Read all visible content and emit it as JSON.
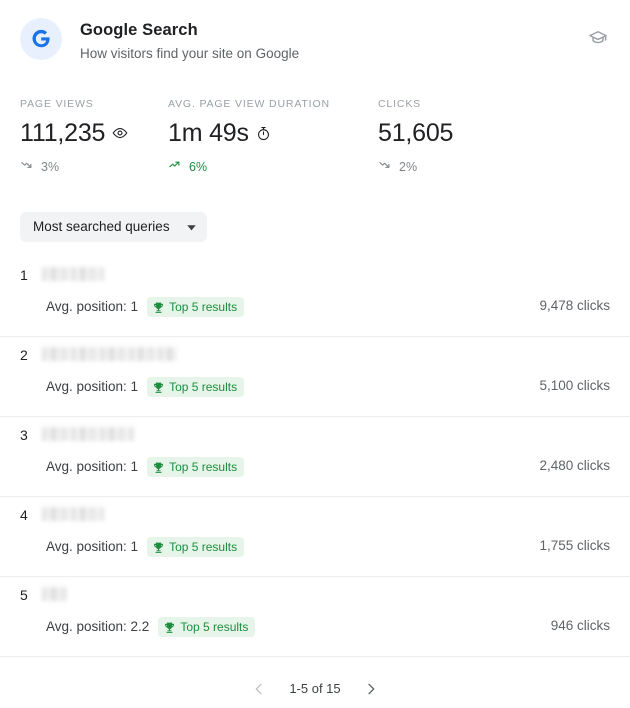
{
  "header": {
    "logo_icon": "google-g-icon",
    "title": "Google Search",
    "subtitle": "How visitors find your site on Google",
    "action_icon": "graduation-cap-icon",
    "logo_color": "#1a73e8",
    "logo_bg": "#e8f0fe"
  },
  "metrics": [
    {
      "label": "PAGE VIEWS",
      "value": "111,235",
      "icon": "eye-icon",
      "trend_direction": "down",
      "trend_icon": "trend-down-icon",
      "trend_value": "3%",
      "trend_color": "#80868b"
    },
    {
      "label": "AVG. PAGE VIEW DURATION",
      "value": "1m 49s",
      "icon": "stopwatch-icon",
      "trend_direction": "up",
      "trend_icon": "trend-up-icon",
      "trend_value": "6%",
      "trend_color": "#1e8e3e"
    },
    {
      "label": "CLICKS",
      "value": "51,605",
      "icon": "",
      "trend_direction": "down",
      "trend_icon": "trend-down-icon",
      "trend_value": "2%",
      "trend_color": "#80868b"
    }
  ],
  "filter": {
    "selected": "Most searched queries",
    "caret_icon": "chevron-down-icon"
  },
  "list": {
    "badge_icon": "trophy-icon",
    "badge_color": "#1e8e3e",
    "badge_bg": "#e6f4ea",
    "rows": [
      {
        "rank": "1",
        "query_redacted": true,
        "query_width": 62,
        "avg_position": "Avg. position: 1",
        "badge_label": "Top 5 results",
        "clicks": "9,478 clicks"
      },
      {
        "rank": "2",
        "query_redacted": true,
        "query_width": 135,
        "avg_position": "Avg. position: 1",
        "badge_label": "Top 5 results",
        "clicks": "5,100 clicks"
      },
      {
        "rank": "3",
        "query_redacted": true,
        "query_width": 92,
        "avg_position": "Avg. position: 1",
        "badge_label": "Top 5 results",
        "clicks": "2,480 clicks"
      },
      {
        "rank": "4",
        "query_redacted": true,
        "query_width": 62,
        "avg_position": "Avg. position: 1",
        "badge_label": "Top 5 results",
        "clicks": "1,755 clicks"
      },
      {
        "rank": "5",
        "query_redacted": true,
        "query_width": 25,
        "avg_position": "Avg. position: 2.2",
        "badge_label": "Top 5 results",
        "clicks": "946 clicks"
      }
    ]
  },
  "pagination": {
    "prev_icon": "chevron-left-icon",
    "next_icon": "chevron-right-icon",
    "range": "1-5 of 15"
  }
}
